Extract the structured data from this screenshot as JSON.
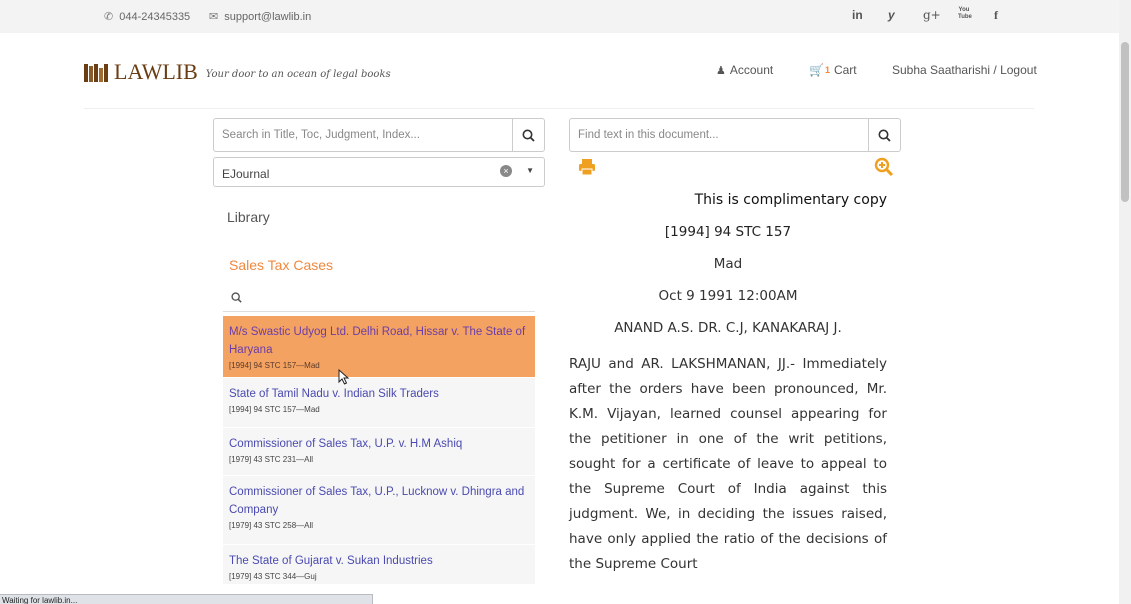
{
  "topbar": {
    "phone": "044-24345335",
    "email": "support@lawlib.in",
    "social": [
      "in",
      "y",
      "g+",
      "You Tube",
      "f"
    ]
  },
  "header": {
    "logo": "LAWLIB",
    "tagline": "Your door to an ocean of legal books",
    "account": "Account",
    "cart_count": "1",
    "cart": "Cart",
    "user": "Subha Saatharishi / Logout"
  },
  "left": {
    "search_placeholder": "Search in Title, Toc, Judgment, Index...",
    "select_value": "EJournal",
    "library": "Library",
    "collection": "Sales Tax Cases",
    "items": [
      {
        "title": "M/s Swastic Udyog Ltd. Delhi Road, Hissar v. The State of Haryana",
        "cite": "[1994] 94 STC 157—Mad"
      },
      {
        "title": "State of Tamil Nadu v. Indian Silk Traders",
        "cite": "[1994] 94 STC 157—Mad"
      },
      {
        "title": "Commissioner of Sales Tax, U.P. v. H.M Ashiq",
        "cite": "[1979] 43 STC 231—All"
      },
      {
        "title": "Commissioner of Sales Tax, U.P., Lucknow v. Dhingra and Company",
        "cite": "[1979] 43 STC 258—All"
      },
      {
        "title": "The State of Gujarat v. Sukan Industries",
        "cite": "[1979] 43 STC 344—Guj"
      }
    ]
  },
  "right": {
    "search_placeholder": "Find text in this document...",
    "complimentary": "This is complimentary copy",
    "citation": "[1994] 94 STC 157",
    "court": "Mad",
    "date": "Oct 9 1991 12:00AM",
    "judges": "ANAND A.S. DR. C.J, KANAKARAJ J.",
    "body": "RAJU and AR. LAKSHMANAN, JJ.- Immediately after the orders have been pronounced, Mr. K.M. Vijayan, learned counsel appearing for the petitioner in one of the writ petitions, sought for a certificate of leave to appeal to the Supreme Court of India against this judgment. We, in deciding the issues raised, have only applied the ratio of the decisions of the Supreme Court"
  },
  "status": "Waiting for lawlib.in...",
  "colors": {
    "accent": "#f0883e",
    "active_row": "#f4a261",
    "link": "#4a4ab0",
    "logo": "#6b3d12"
  }
}
